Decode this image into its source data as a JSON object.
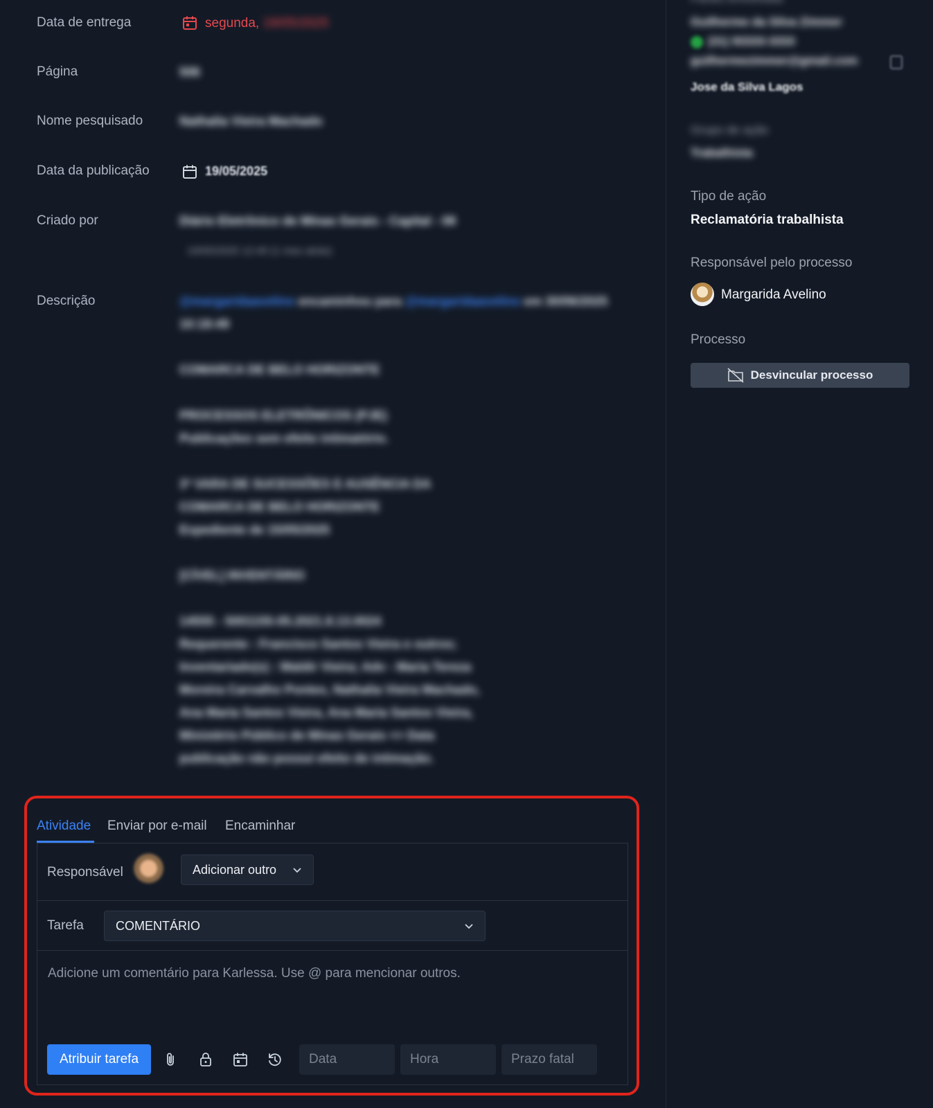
{
  "details": {
    "fields": [
      {
        "label": "Data de entrega",
        "value": "segunda, 19/05/2025"
      },
      {
        "label": "Página",
        "value": "506"
      },
      {
        "label": "Nome pesquisado",
        "value": "Nathalia Vieira Machado"
      },
      {
        "label": "Data da publicação",
        "value": "19/05/2025"
      },
      {
        "label": "Criado por",
        "value": "Diário Eletrônico de Minas Gerais - Capital - 08",
        "sub": "19/05/2025 12:40 (1 mes atrás)"
      },
      {
        "label": "Descrição"
      }
    ],
    "delivery_day": "segunda,",
    "delivery_date": "19/05/2025",
    "description": {
      "mention1": "@margaridaavelino",
      "text1": "encaminhou para",
      "mention2": "@margaridaavelino",
      "text2": "em 30/06/2025",
      "time": "10:18:49",
      "lines": [
        "COMARCA DE BELO HORIZONTE",
        "",
        "PROCESSOS ELETRÔNICOS (PJE)",
        "Publicações sem efeito intimatório.",
        "",
        "3ª VARA DE SUCESSÕES E AUSÊNCIA DA",
        "COMARCA DE BELO HORIZONTE",
        "Expediente de 15/05/2025",
        "",
        "[CÍVEL] INVENTÁRIO",
        "",
        "14555 - 5001155-05.2021.8.13.0024",
        "Requerente : Francisco Santos Vieira e outros;",
        "Inventariado(s) : Waldir Vieira; Adv - Maria Tereza",
        "Moreira Carvalho Pontes, Nathalia Vieira Machado,",
        "Ana Maria Santos Vieira, Ana Maria Santos Vieira,",
        "Ministério Público de Minas Gerais <> Data",
        "publicação não possui efeito de intimação."
      ]
    }
  },
  "sidebar": {
    "parties_label": "Partes envolvidas",
    "party_name": "Guilherme da Silva Zimmer",
    "party_phone": "(31) 93333-3333",
    "party_email": "guilhermezimmer@gmail.com",
    "party2_name": "Jose da Silva Lagos",
    "action_group_label": "Grupo de ação",
    "action_group_value": "Trabalhista",
    "action_type_label": "Tipo de ação",
    "action_type_value": "Reclamatória trabalhista",
    "responsible_label": "Responsável pelo processo",
    "responsible_name": "Margarida Avelino",
    "process_label": "Processo",
    "unlink_label": "Desvincular processo"
  },
  "activity": {
    "tabs": [
      "Atividade",
      "Enviar por e-mail",
      "Encaminhar"
    ],
    "responsible_label": "Responsável",
    "add_other": "Adicionar outro",
    "task_label": "Tarefa",
    "task_value": "COMENTÁRIO",
    "comment_placeholder": "Adicione um comentário para Karlessa. Use @ para mencionar outros.",
    "assign_button": "Atribuir tarefa",
    "date_placeholder": "Data",
    "time_placeholder": "Hora",
    "deadline_placeholder": "Prazo fatal"
  },
  "colors": {
    "accent": "#3b82f6",
    "danger": "#e5484d",
    "highlight": "#e0241b",
    "background": "#131a26"
  },
  "icons": [
    "calendar-icon",
    "unlink-folder-icon",
    "chevron-down-icon",
    "paperclip-icon",
    "lock-icon",
    "calendar-icon",
    "history-icon",
    "whatsapp-icon",
    "copy-icon"
  ]
}
